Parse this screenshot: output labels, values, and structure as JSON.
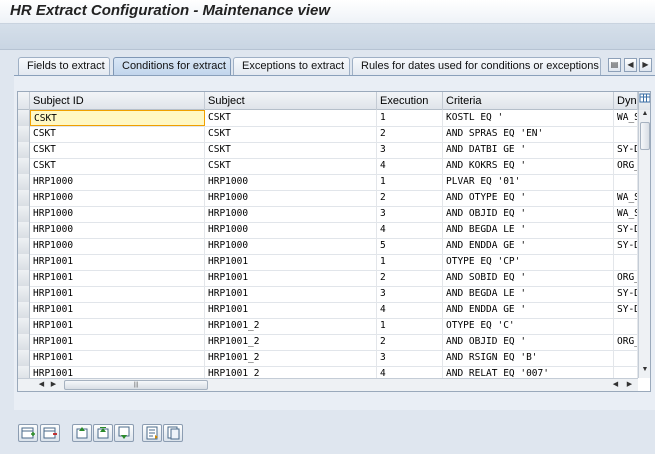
{
  "window": {
    "title": "HR Extract Configuration - Maintenance view"
  },
  "tabs": [
    {
      "label": "Fields to extract",
      "active": false
    },
    {
      "label": "Conditions for extract",
      "active": true
    },
    {
      "label": "Exceptions to extract",
      "active": false
    },
    {
      "label": "Rules for dates used for conditions or exceptions",
      "active": false
    }
  ],
  "table": {
    "columns": [
      "Subject ID",
      "Subject",
      "Execution",
      "Criteria",
      "Dyna"
    ],
    "rows": [
      [
        "CSKT",
        "CSKT",
        "1",
        "KOSTL EQ '",
        "WA_S"
      ],
      [
        "CSKT",
        "CSKT",
        "2",
        "AND SPRAS EQ 'EN'",
        ""
      ],
      [
        "CSKT",
        "CSKT",
        "3",
        "AND DATBI GE '",
        "SY-D"
      ],
      [
        "CSKT",
        "CSKT",
        "4",
        "AND KOKRS EQ '",
        "ORG_"
      ],
      [
        "HRP1000",
        "HRP1000",
        "1",
        "PLVAR EQ '01'",
        ""
      ],
      [
        "HRP1000",
        "HRP1000",
        "2",
        "AND OTYPE EQ '",
        "WA_S"
      ],
      [
        "HRP1000",
        "HRP1000",
        "3",
        "AND OBJID EQ '",
        "WA_S"
      ],
      [
        "HRP1000",
        "HRP1000",
        "4",
        "AND BEGDA LE '",
        "SY-D"
      ],
      [
        "HRP1000",
        "HRP1000",
        "5",
        "AND ENDDA GE '",
        "SY-D"
      ],
      [
        "HRP1001",
        "HRP1001",
        "1",
        "OTYPE EQ 'CP'",
        ""
      ],
      [
        "HRP1001",
        "HRP1001",
        "2",
        "AND SOBID EQ '",
        "ORG_"
      ],
      [
        "HRP1001",
        "HRP1001",
        "3",
        "AND BEGDA LE '",
        "SY-D"
      ],
      [
        "HRP1001",
        "HRP1001",
        "4",
        "AND ENDDA GE '",
        "SY-D"
      ],
      [
        "HRP1001",
        "HRP1001_2",
        "1",
        "OTYPE EQ 'C'",
        ""
      ],
      [
        "HRP1001",
        "HRP1001_2",
        "2",
        "AND OBJID EQ '",
        "ORG_"
      ],
      [
        "HRP1001",
        "HRP1001_2",
        "3",
        "AND RSIGN EQ 'B'",
        ""
      ],
      [
        "HRP1001",
        "HRP1001_2",
        "4",
        "AND RELAT EQ '007'",
        ""
      ]
    ],
    "selected_row": 0
  },
  "toolbar_buttons": [
    "insert-row-icon",
    "delete-row-icon",
    "move-up-icon",
    "move-top-icon",
    "move-down-icon",
    "detail-icon",
    "copy-icon"
  ],
  "colors": {
    "accent": "#f0a000",
    "tab_active": "#c2d5ec"
  }
}
